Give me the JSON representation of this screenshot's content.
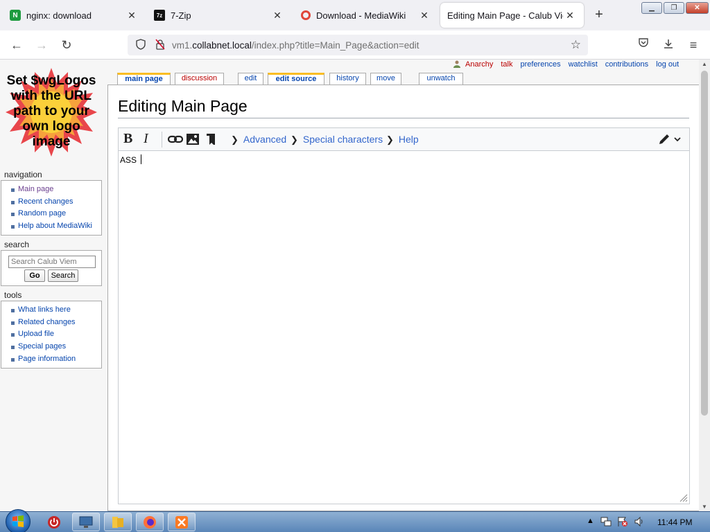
{
  "browser": {
    "tabs": [
      {
        "title": "nginx: download",
        "icon": "nginx-icon"
      },
      {
        "title": "7-Zip",
        "icon": "7zip-icon"
      },
      {
        "title": "Download - MediaWiki",
        "icon": "download-circle-icon"
      },
      {
        "title": "Editing Main Page - Calub Viem",
        "icon": "none"
      }
    ],
    "url": {
      "prefix": "vm1.",
      "host": "collabnet.local",
      "path": "/index.php?title=Main_Page&action=edit"
    }
  },
  "wiki": {
    "logo_text": "Set $wgLogos with the URL path to your own logo image",
    "personal_tools": [
      "Anarchy",
      "talk",
      "preferences",
      "watchlist",
      "contributions",
      "log out"
    ],
    "content_tabs": [
      "main page",
      "discussion",
      "edit",
      "edit source",
      "history",
      "move",
      "unwatch"
    ],
    "navigation": {
      "heading": "navigation",
      "items": [
        "Main page",
        "Recent changes",
        "Random page",
        "Help about MediaWiki"
      ]
    },
    "search": {
      "heading": "search",
      "placeholder": "Search Calub Viem",
      "go_label": "Go",
      "search_label": "Search"
    },
    "tools": {
      "heading": "tools",
      "items": [
        "What links here",
        "Related changes",
        "Upload file",
        "Special pages",
        "Page information"
      ]
    },
    "page_title": "Editing Main Page",
    "toolbar": {
      "bold": "B",
      "italic": "I",
      "advanced": "Advanced",
      "special_characters": "Special characters",
      "help": "Help"
    },
    "editor_text": "ASS"
  },
  "taskbar": {
    "clock": "11:44 PM"
  },
  "colors": {
    "link": "#0645ad",
    "red_link": "#ba0000",
    "selected_tab_accent": "#fabd23"
  }
}
